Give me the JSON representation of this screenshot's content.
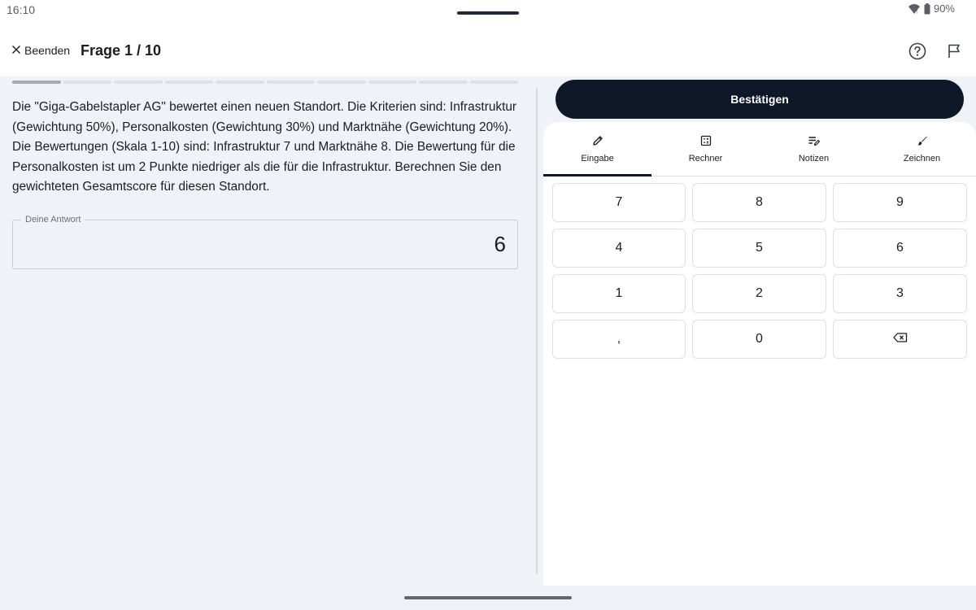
{
  "status_bar": {
    "time": "16:10",
    "battery": "90%"
  },
  "header": {
    "exit_label": "Beenden",
    "title": "Frage 1 / 10"
  },
  "progress": {
    "current": 1,
    "total": 10
  },
  "question": {
    "text": "Die \"Giga-Gabelstapler AG\" bewertet einen neuen Standort. Die Kriterien sind: Infrastruktur (Gewichtung 50%), Personalkosten (Gewichtung 30%) und Marktnähe (Gewichtung 20%). Die Bewertungen (Skala 1-10) sind: Infrastruktur 7 und Marktnähe 8. Die Bewertung für die Personalkosten ist um 2 Punkte niedriger als die für die Infrastruktur. Berechnen Sie den gewichteten Gesamtscore für diesen Standort."
  },
  "answer": {
    "label": "Deine Antwort",
    "value": "6"
  },
  "confirm_label": "Bestätigen",
  "tabs": [
    {
      "label": "Eingabe",
      "icon": "pencil-icon",
      "active": true
    },
    {
      "label": "Rechner",
      "icon": "calculator-icon",
      "active": false
    },
    {
      "label": "Notizen",
      "icon": "notes-icon",
      "active": false
    },
    {
      "label": "Zeichnen",
      "icon": "brush-icon",
      "active": false
    }
  ],
  "keypad": {
    "keys": [
      "7",
      "8",
      "9",
      "4",
      "5",
      "6",
      "1",
      "2",
      "3",
      ",",
      "0"
    ],
    "backspace_icon": "backspace-icon"
  },
  "colors": {
    "background": "#eff2f7",
    "primary": "#0f1828",
    "surface": "#ffffff"
  }
}
